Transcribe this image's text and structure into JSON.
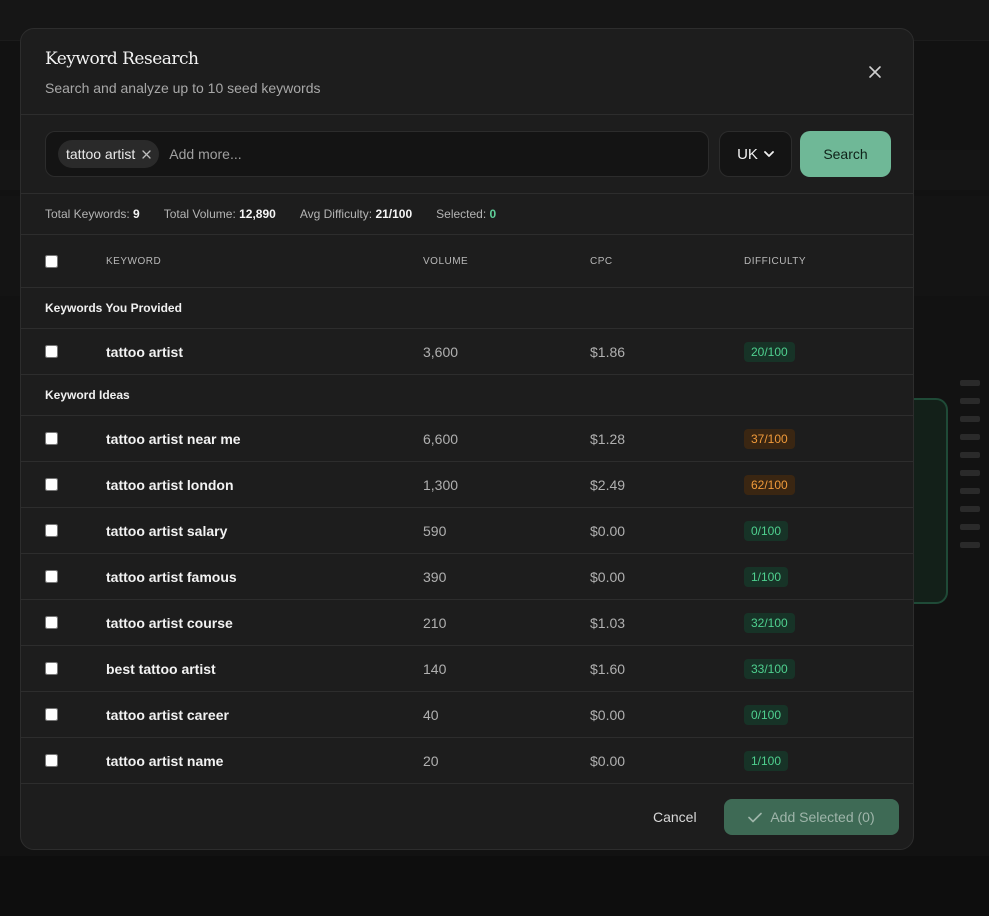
{
  "modal": {
    "title": "Keyword Research",
    "subtitle": "Search and analyze up to 10 seed keywords"
  },
  "search": {
    "chips": [
      "tattoo artist"
    ],
    "placeholder": "Add more...",
    "country": "UK",
    "button_label": "Search"
  },
  "stats": {
    "total_keywords_label": "Total Keywords:",
    "total_keywords": "9",
    "total_volume_label": "Total Volume:",
    "total_volume": "12,890",
    "avg_difficulty_label": "Avg Difficulty:",
    "avg_difficulty": "21/100",
    "selected_label": "Selected:",
    "selected": "0"
  },
  "table": {
    "headers": {
      "keyword": "KEYWORD",
      "volume": "VOLUME",
      "cpc": "CPC",
      "difficulty": "DIFFICULTY"
    },
    "sections": [
      {
        "label": "Keywords You Provided",
        "rows": [
          {
            "keyword": "tattoo artist",
            "volume": "3,600",
            "cpc": "$1.86",
            "difficulty": "20/100",
            "level": "green"
          }
        ]
      },
      {
        "label": "Keyword Ideas",
        "rows": [
          {
            "keyword": "tattoo artist near me",
            "volume": "6,600",
            "cpc": "$1.28",
            "difficulty": "37/100",
            "level": "orange"
          },
          {
            "keyword": "tattoo artist london",
            "volume": "1,300",
            "cpc": "$2.49",
            "difficulty": "62/100",
            "level": "orange"
          },
          {
            "keyword": "tattoo artist salary",
            "volume": "590",
            "cpc": "$0.00",
            "difficulty": "0/100",
            "level": "green"
          },
          {
            "keyword": "tattoo artist famous",
            "volume": "390",
            "cpc": "$0.00",
            "difficulty": "1/100",
            "level": "green"
          },
          {
            "keyword": "tattoo artist course",
            "volume": "210",
            "cpc": "$1.03",
            "difficulty": "32/100",
            "level": "green"
          },
          {
            "keyword": "best tattoo artist",
            "volume": "140",
            "cpc": "$1.60",
            "difficulty": "33/100",
            "level": "green"
          },
          {
            "keyword": "tattoo artist career",
            "volume": "40",
            "cpc": "$0.00",
            "difficulty": "0/100",
            "level": "green"
          },
          {
            "keyword": "tattoo artist name",
            "volume": "20",
            "cpc": "$0.00",
            "difficulty": "1/100",
            "level": "green"
          }
        ]
      }
    ]
  },
  "footer": {
    "cancel_label": "Cancel",
    "add_label": "Add Selected (0)"
  },
  "colors": {
    "accent": "#6fb897",
    "badge_green_text": "#4fd08f",
    "badge_orange_text": "#f09a3a",
    "modal_bg": "#1d1d1d"
  },
  "icons": {
    "close": "close-icon",
    "chip_remove": "close-icon",
    "country_dropdown": "chevron-down-icon",
    "add_check": "check-icon"
  }
}
